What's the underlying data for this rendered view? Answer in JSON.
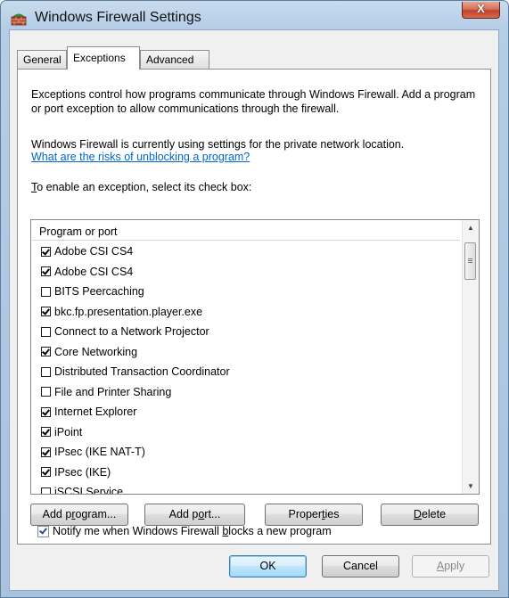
{
  "window": {
    "title": "Windows Firewall Settings",
    "close_label": "X"
  },
  "tabs": [
    {
      "label": "General",
      "active": false
    },
    {
      "label": "Exceptions",
      "active": true
    },
    {
      "label": "Advanced",
      "active": false
    }
  ],
  "exceptions": {
    "description": "Exceptions control how programs communicate through Windows Firewall. Add a program or port exception to allow communications through the firewall.",
    "status_text": "Windows Firewall is currently using settings for the private network location.",
    "risks_link": "What are the risks of unblocking a program?",
    "instruction_prefix": "T",
    "instruction_rest": "o enable an exception, select its check box:",
    "list_header": "Program or port",
    "items": [
      {
        "label": "Adobe CSI CS4",
        "checked": true
      },
      {
        "label": "Adobe CSI CS4",
        "checked": true
      },
      {
        "label": "BITS Peercaching",
        "checked": false
      },
      {
        "label": "bkc.fp.presentation.player.exe",
        "checked": true
      },
      {
        "label": "Connect to a Network Projector",
        "checked": false
      },
      {
        "label": "Core Networking",
        "checked": true
      },
      {
        "label": "Distributed Transaction Coordinator",
        "checked": false
      },
      {
        "label": "File and Printer Sharing",
        "checked": false
      },
      {
        "label": "Internet Explorer",
        "checked": true
      },
      {
        "label": "iPoint",
        "checked": true
      },
      {
        "label": "IPsec (IKE NAT-T)",
        "checked": true
      },
      {
        "label": "IPsec (IKE)",
        "checked": true
      },
      {
        "label": "iSCSI Service",
        "checked": false
      }
    ],
    "buttons": {
      "add_program_pre": "Add p",
      "add_program_u": "r",
      "add_program_post": "ogram...",
      "add_port_pre": "Add p",
      "add_port_u": "o",
      "add_port_post": "rt...",
      "properties_pre": "Proper",
      "properties_u": "t",
      "properties_post": "ies",
      "delete_pre": "",
      "delete_u": "D",
      "delete_post": "elete"
    },
    "notify_pre": "Notify me when Windows Firewall ",
    "notify_u": "b",
    "notify_post": "locks a new program",
    "notify_checked": true
  },
  "dialog_buttons": {
    "ok": "OK",
    "cancel": "Cancel",
    "apply_u": "A",
    "apply_post": "pply"
  },
  "icons": [
    "firewall-icon",
    "close-icon",
    "scroll-up-arrow-icon",
    "scroll-down-arrow-icon"
  ]
}
